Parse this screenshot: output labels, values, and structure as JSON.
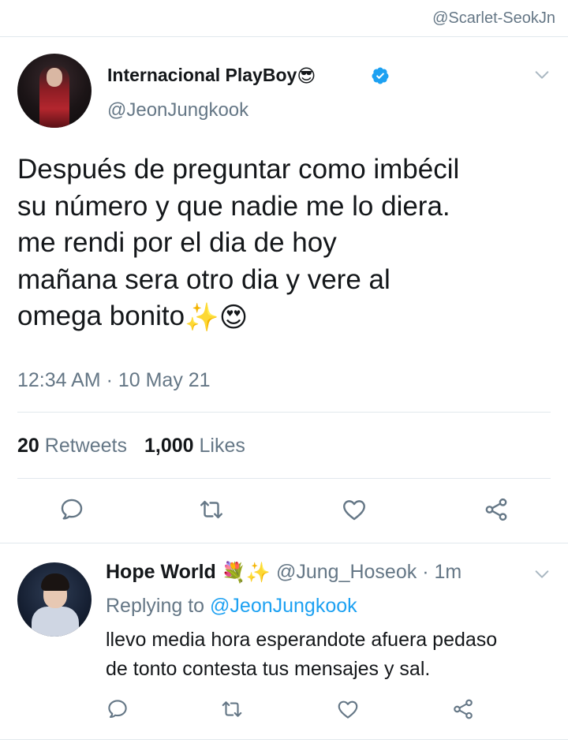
{
  "watermark": "@Scarlet-SeokJn",
  "main_tweet": {
    "display_name": "Internacional PlayBoy",
    "name_emoji": "😎",
    "verified_icon": "verified-badge-icon",
    "handle": "@JeonJungkook",
    "text_lines": [
      "Después de preguntar como imbécil",
      "su número y que nadie me lo diera.",
      "me rendi por el dia de hoy",
      "mañana sera otro dia y vere al",
      "omega bonito"
    ],
    "text_emojis": "✨😍",
    "timestamp": "12:34 AM · 10 May 21",
    "retweets_count": "20",
    "retweets_label": "Retweets",
    "likes_count": "1,000",
    "likes_label": "Likes",
    "actions": [
      "reply-icon",
      "retweet-icon",
      "like-icon",
      "share-icon"
    ]
  },
  "reply_tweet": {
    "display_name": "Hope World",
    "name_emojis": "💐✨",
    "handle": "@Jung_Hoseok",
    "time": "1m",
    "separator": "·",
    "replying_prefix": "Replying to",
    "replying_to": "@JeonJungkook",
    "text_lines": [
      "llevo media hora esperandote afuera pedaso",
      "de tonto contesta tus mensajes y sal."
    ],
    "actions": [
      "reply-icon",
      "retweet-icon",
      "like-icon",
      "share-icon"
    ]
  },
  "colors": {
    "text_primary": "#14171a",
    "text_secondary": "#657786",
    "link_blue": "#1da1f2",
    "divider": "#e1e8ed"
  }
}
